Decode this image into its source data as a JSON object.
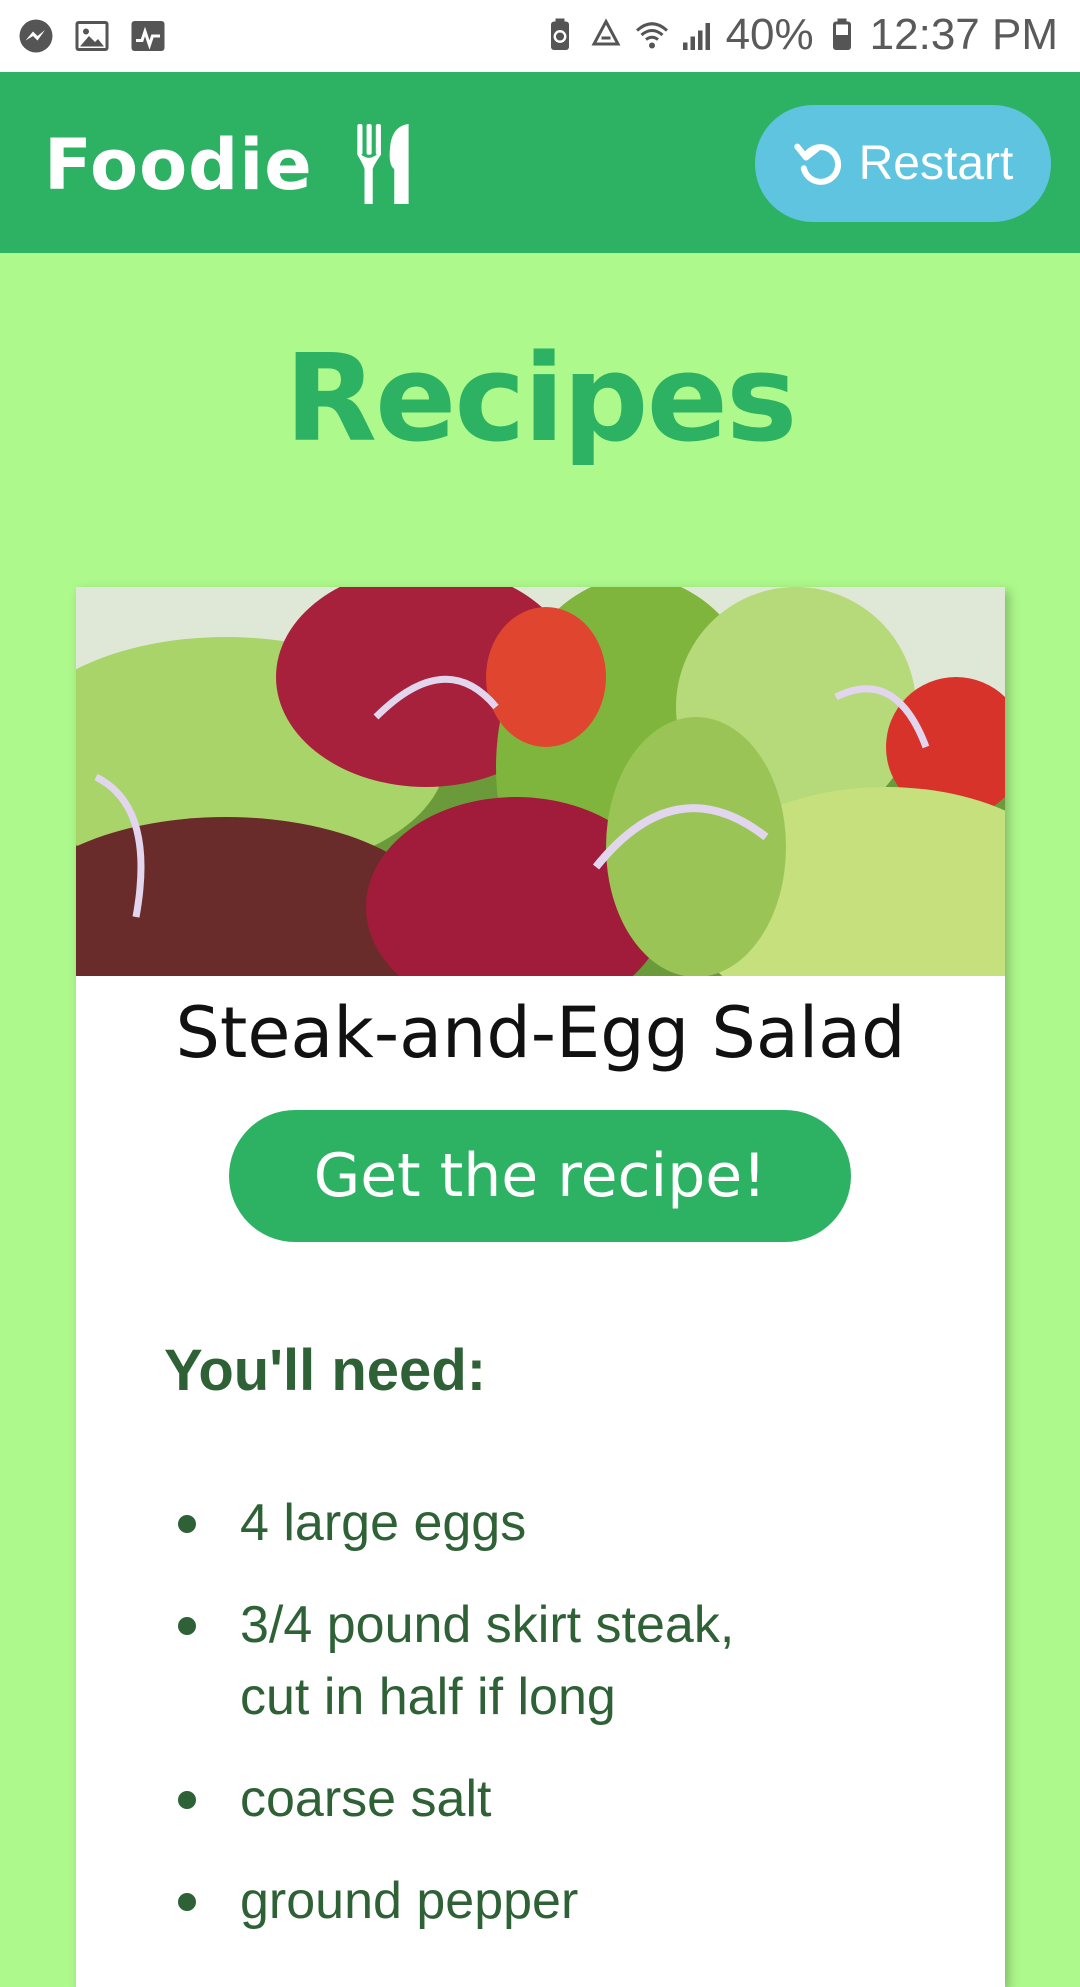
{
  "status_bar": {
    "battery": "40%",
    "time": "12:37 PM",
    "left_icons": [
      "messenger-icon",
      "image-icon",
      "activity-icon"
    ],
    "right_icons": [
      "battery-saver-icon",
      "recycle-icon",
      "wifi-icon",
      "signal-icon",
      "battery-icon"
    ]
  },
  "header": {
    "brand": "Foodie",
    "brand_icon": "fork-knife-icon",
    "restart_label": "Restart",
    "restart_icon": "restart-icon",
    "background": "#2db264",
    "button_color": "#5ec4df"
  },
  "page": {
    "title": "Recipes",
    "background": "#adf98c",
    "title_color": "#2db264"
  },
  "recipe": {
    "title": "Steak-and-Egg Salad",
    "button_label": "Get the recipe!",
    "needs_heading": "You'll need:",
    "ingredients": [
      "4 large eggs",
      "3/4 pound skirt steak,\ncut in half if long",
      "coarse salt",
      "ground pepper"
    ],
    "text_color": "#2f6136"
  }
}
